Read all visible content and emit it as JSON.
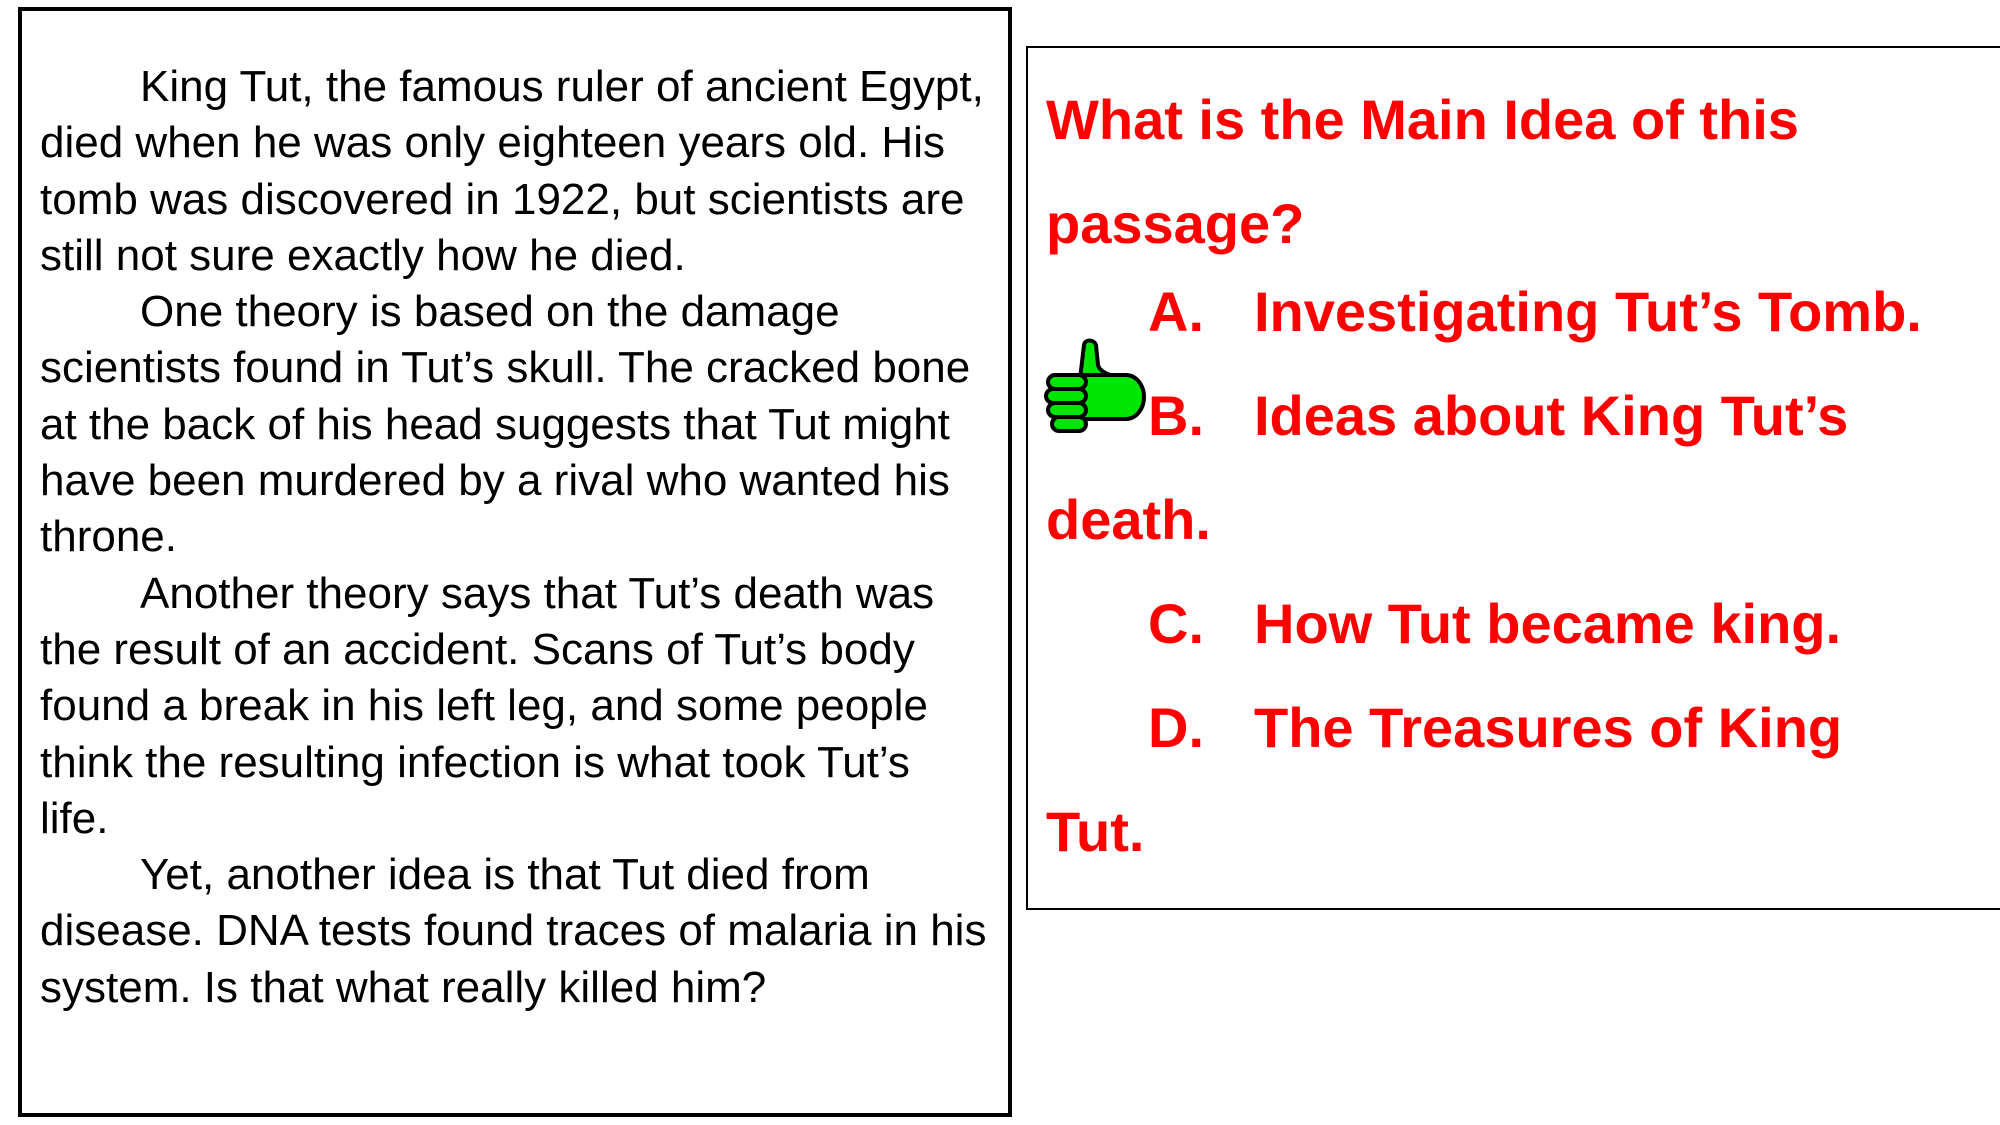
{
  "passage": {
    "paragraphs": [
      "King Tut, the famous ruler of ancient Egypt, died when he was only eighteen years old.  His tomb was discovered in 1922, but scientists are still not sure exactly how he died.",
      "One theory is based on the damage scientists found in Tut’s skull. The cracked bone at the back of his head suggests that Tut might have been murdered by a rival who wanted his throne.",
      "Another theory says that Tut’s death was the result of an accident.  Scans of Tut’s body found a break in his left leg, and some people think the resulting infection is what took Tut’s life.",
      "Yet, another idea is that Tut died from disease.  DNA tests found traces of malaria in his system.  Is that what really killed him?"
    ]
  },
  "question": {
    "prompt": "What is the Main Idea of this passage?",
    "options": [
      {
        "letter": "A.",
        "text": "Investigating Tut’s Tomb."
      },
      {
        "letter": "B.",
        "text": "Ideas about King Tut’s",
        "continuation": "death."
      },
      {
        "letter": "C.",
        "text": "How Tut became king."
      },
      {
        "letter": "D.",
        "text": "The Treasures of King",
        "continuation": "Tut."
      }
    ],
    "selected_icon": "thumbs-up-icon"
  },
  "colors": {
    "question_text": "#ff0000",
    "thumb_fill": "#00e600",
    "border": "#000000"
  }
}
